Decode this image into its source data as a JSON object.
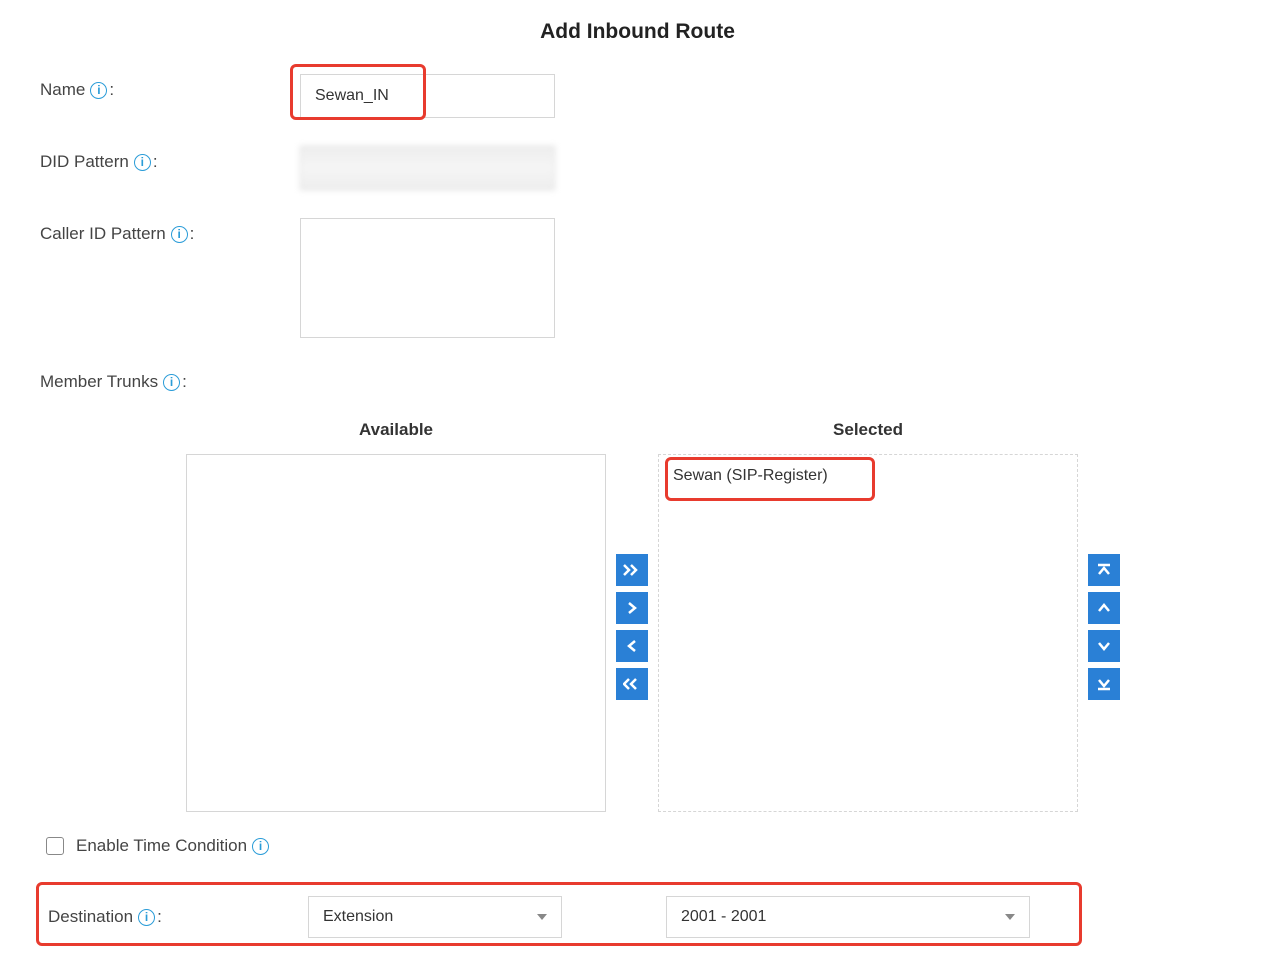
{
  "title": "Add Inbound Route",
  "labels": {
    "name": "Name",
    "did_pattern": "DID Pattern",
    "caller_id_pattern": "Caller ID Pattern",
    "member_trunks": "Member Trunks",
    "available": "Available",
    "selected": "Selected",
    "enable_time": "Enable Time Condition",
    "destination": "Destination",
    "info_glyph": "i",
    "colon": ":"
  },
  "values": {
    "name": "Sewan_IN",
    "did_pattern": "",
    "caller_id_pattern": "",
    "available_items": [],
    "selected_items": [
      "Sewan (SIP-Register)"
    ],
    "enable_time_checked": false,
    "destination_type": "Extension",
    "destination_target": "2001 - 2001"
  }
}
